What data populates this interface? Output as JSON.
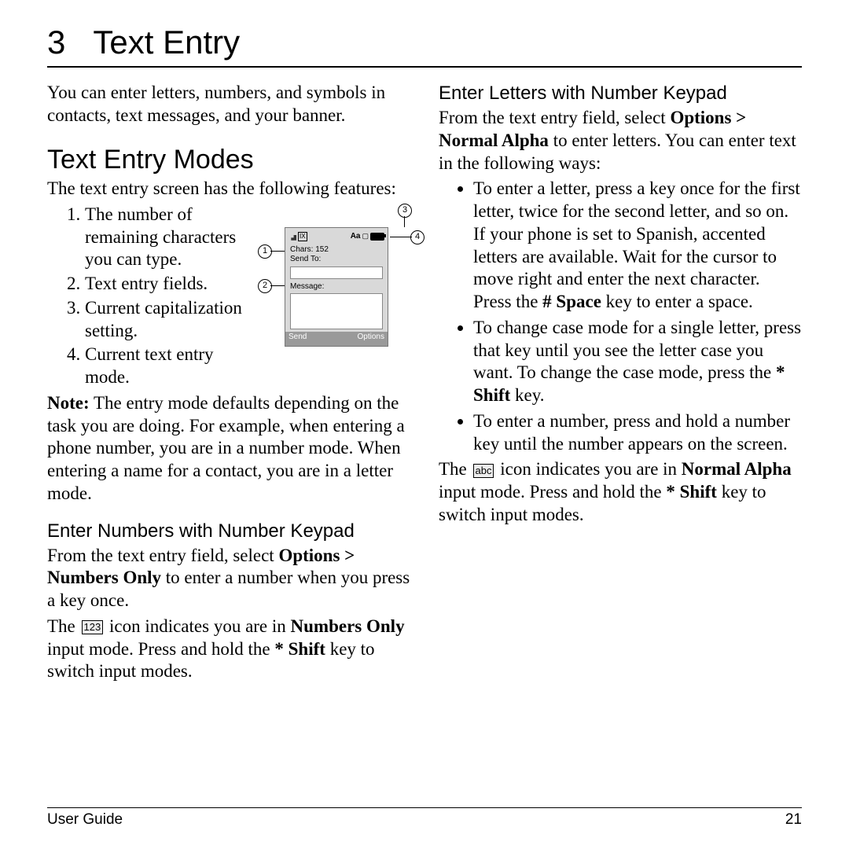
{
  "chapter": {
    "number": "3",
    "title": "Text Entry"
  },
  "intro": "You can enter letters, numbers, and symbols in contacts, text messages, and your banner.",
  "section1": {
    "heading": "Text Entry Modes",
    "lead_in": "The text entry screen has the following features:",
    "features": [
      "The number of remaining characters you can type.",
      "Text entry fields.",
      "Current capitalization setting.",
      "Current text entry mode."
    ],
    "note_label": "Note:",
    "note_text": " The entry mode defaults depending on the task you are doing. For example, when entering a phone number, you are in a number mode. When entering a name for a contact, you are in a letter mode."
  },
  "phone_diagram": {
    "chars_label": "Chars: 152",
    "send_to_label": "Send To:",
    "message_label": "Message:",
    "softkey_left": "Send",
    "softkey_right": "Options",
    "top_aa": "Aa",
    "callouts": {
      "c1": "1",
      "c2": "2",
      "c3": "3",
      "c4": "4"
    }
  },
  "numbers_section": {
    "heading": "Enter Numbers with Number Keypad",
    "p1_a": "From the text entry field, select ",
    "p1_b_bold": "Options > Numbers Only",
    "p1_c": " to enter a number when you press a key once.",
    "p2_a": "The ",
    "icon_label": "123",
    "p2_b": " icon indicates you are in ",
    "p2_c_bold": "Numbers Only",
    "p2_d": " input mode. Press and hold the ",
    "p2_e_bold": "* Shift",
    "p2_f": " key to switch input modes."
  },
  "letters_section": {
    "heading": "Enter Letters with Number Keypad",
    "p1_a": "From the text entry field, select ",
    "p1_b_bold": "Options > Normal Alpha",
    "p1_c": " to enter letters. You can enter text in the following ways:",
    "bullets": {
      "b1_a": "To enter a letter, press a key once for the first letter, twice for the second letter, and so on. If your phone is set to Spanish, accented letters are available. Wait for the cursor to move right and enter the next character. Press the ",
      "b1_b_bold": "# Space",
      "b1_c": " key to enter a space.",
      "b2_a": "To change case mode for a single letter, press that key until you see the letter case you want. To change the case mode, press the ",
      "b2_b_bold": "* Shift",
      "b2_c": " key.",
      "b3": "To enter a number, press and hold a number key until the number appears on the screen."
    },
    "p2_a": "The ",
    "icon_label": "abc",
    "p2_b": " icon indicates you are in ",
    "p2_c_bold": "Normal Alpha",
    "p2_d": " input mode. Press and hold the ",
    "p2_e_bold": "* Shift",
    "p2_f": " key to switch input modes."
  },
  "footer": {
    "left": "User Guide",
    "right": "21"
  }
}
